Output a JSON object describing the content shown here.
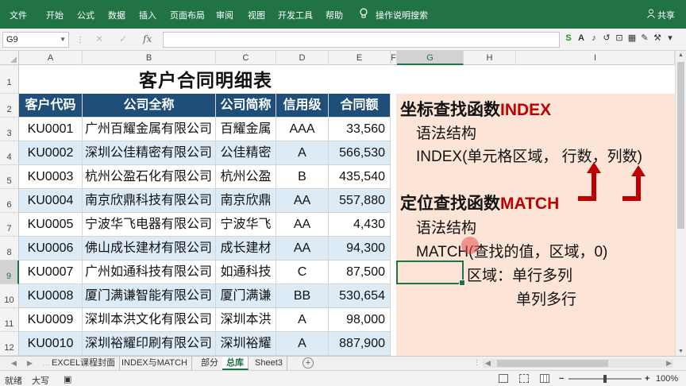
{
  "ribbon": {
    "tabs": [
      "文件",
      "开始",
      "公式",
      "数据",
      "插入",
      "页面布局",
      "审阅",
      "视图",
      "开发工具",
      "帮助"
    ],
    "search": "操作说明搜索",
    "share": "共享"
  },
  "formula_bar": {
    "name_box": "G9",
    "fx": "fx",
    "value": ""
  },
  "columns": [
    "A",
    "B",
    "C",
    "D",
    "E",
    "F",
    "G",
    "H",
    "I"
  ],
  "rows": [
    "1",
    "2",
    "3",
    "4",
    "5",
    "6",
    "7",
    "8",
    "9",
    "10",
    "11",
    "12"
  ],
  "sheet": {
    "title": "客户合同明细表",
    "headers": [
      "客户代码",
      "公司全称",
      "公司简称",
      "信用级",
      "合同额"
    ],
    "data": [
      [
        "KU0001",
        "广州百耀金属有限公司",
        "百耀金属",
        "AAA",
        "33,560"
      ],
      [
        "KU0002",
        "深圳公佳精密有限公司",
        "公佳精密",
        "A",
        "566,530"
      ],
      [
        "KU0003",
        "杭州公盈石化有限公司",
        "杭州公盈",
        "B",
        "435,540"
      ],
      [
        "KU0004",
        "南京欣鼎科技有限公司",
        "南京欣鼎",
        "AA",
        "557,880"
      ],
      [
        "KU0005",
        "宁波华飞电器有限公司",
        "宁波华飞",
        "AA",
        "4,430"
      ],
      [
        "KU0006",
        "佛山成长建材有限公司",
        "成长建材",
        "AA",
        "94,300"
      ],
      [
        "KU0007",
        "广州如通科技有限公司",
        "如通科技",
        "C",
        "87,500"
      ],
      [
        "KU0008",
        "厦门满谦智能有限公司",
        "厦门满谦",
        "BB",
        "530,654"
      ],
      [
        "KU0009",
        "深圳本洪文化有限公司",
        "深圳本洪",
        "A",
        "98,000"
      ],
      [
        "KU0010",
        "深圳裕耀印刷有限公司",
        "深圳裕耀",
        "A",
        "887,900"
      ]
    ]
  },
  "notes": {
    "index_prefix": "坐标查找函数",
    "index_name": "INDEX",
    "syntax1": "语法结构",
    "index_syntax": "INDEX(单元格区域，  行数，列数)",
    "match_prefix": "定位查找函数",
    "match_name": "MATCH",
    "syntax2": "语法结构",
    "match_syntax": "MATCH(查找的值，区域，0)",
    "region_line1": "区域：单行多列",
    "region_line2": "单列多行"
  },
  "sheet_tabs": [
    "EXCEL课程封面",
    "INDEX与MATCH",
    "部分",
    "总库",
    "Sheet3"
  ],
  "active_sheet": "总库",
  "status": {
    "mode": "就绪",
    "caps": "大写",
    "zoom": "100%"
  },
  "colors": {
    "excel_green": "#217346",
    "header_blue": "#1f4e78",
    "row_alt": "#ddebf7",
    "note_bg": "#fce4d6",
    "note_red": "#c00000"
  }
}
